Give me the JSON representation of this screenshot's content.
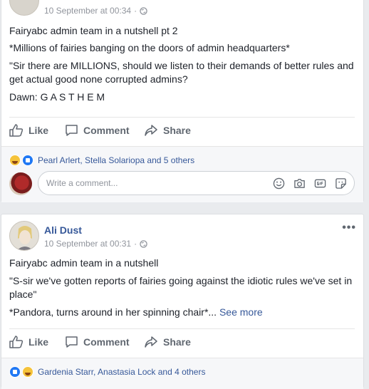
{
  "posts": [
    {
      "timestamp": "10 September at 00:34",
      "lines": [
        "Fairyabc admin team in a nutshell pt 2",
        "*Millions of fairies banging on the doors of admin headquarters*",
        "\"Sir there are MILLIONS, should we listen to their demands of better rules and get actual good none corrupted admins?",
        "Dawn: G A S T H E M"
      ],
      "actions": {
        "like": "Like",
        "comment": "Comment",
        "share": "Share"
      },
      "reactions_text": "Pearl Arlert, Stella Solariopa and 5 others",
      "comment_placeholder": "Write a comment..."
    },
    {
      "author": "Ali Dust",
      "timestamp": "10 September at 00:31",
      "lines": [
        "Fairyabc admin team in a nutshell",
        "\"S-sir we've gotten reports of fairies going against the idiotic rules we've set in place\"",
        "*Pandora, turns around in her spinning chair*..."
      ],
      "see_more": "See more",
      "actions": {
        "like": "Like",
        "comment": "Comment",
        "share": "Share"
      },
      "reactions_text": "Gardenia Starr, Anastasia Lock and 4 others"
    }
  ],
  "more_icon": "•••",
  "meta_separator": "·"
}
